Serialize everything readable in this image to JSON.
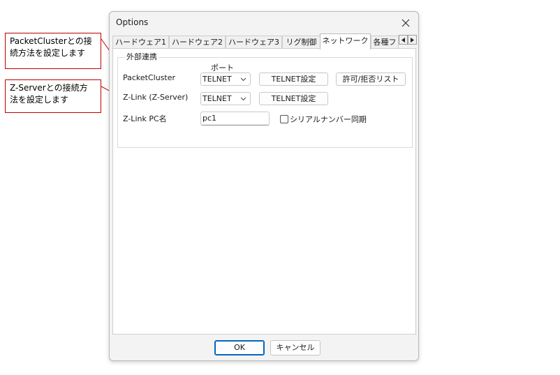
{
  "callouts": {
    "packetcluster": "PacketClusterとの接\n続方法を設定します",
    "zserver": "Z-Serverとの接続方\n法を設定します"
  },
  "window": {
    "title": "Options"
  },
  "tabs": [
    {
      "label": "ハードウェア1"
    },
    {
      "label": "ハードウェア2"
    },
    {
      "label": "ハードウェア3"
    },
    {
      "label": "リグ制御"
    },
    {
      "label": "ネットワーク"
    },
    {
      "label": "各種フ"
    }
  ],
  "group": {
    "label": "外部連携",
    "port_header": "ポート",
    "packetcluster": {
      "label": "PacketCluster",
      "port": "TELNET",
      "telnet_button": "TELNET設定",
      "allow_deny_button": "許可/拒否リスト"
    },
    "zlink": {
      "label": "Z-Link (Z-Server)",
      "port": "TELNET",
      "telnet_button": "TELNET設定"
    },
    "pcname": {
      "label": "Z-Link PC名",
      "value": "pc1",
      "serial_label": "シリアルナンバー同期",
      "serial_checked": false
    }
  },
  "footer": {
    "ok": "OK",
    "cancel": "キャンセル"
  },
  "colors": {
    "callout_border": "#c00000",
    "default_button_border": "#0067c0"
  }
}
